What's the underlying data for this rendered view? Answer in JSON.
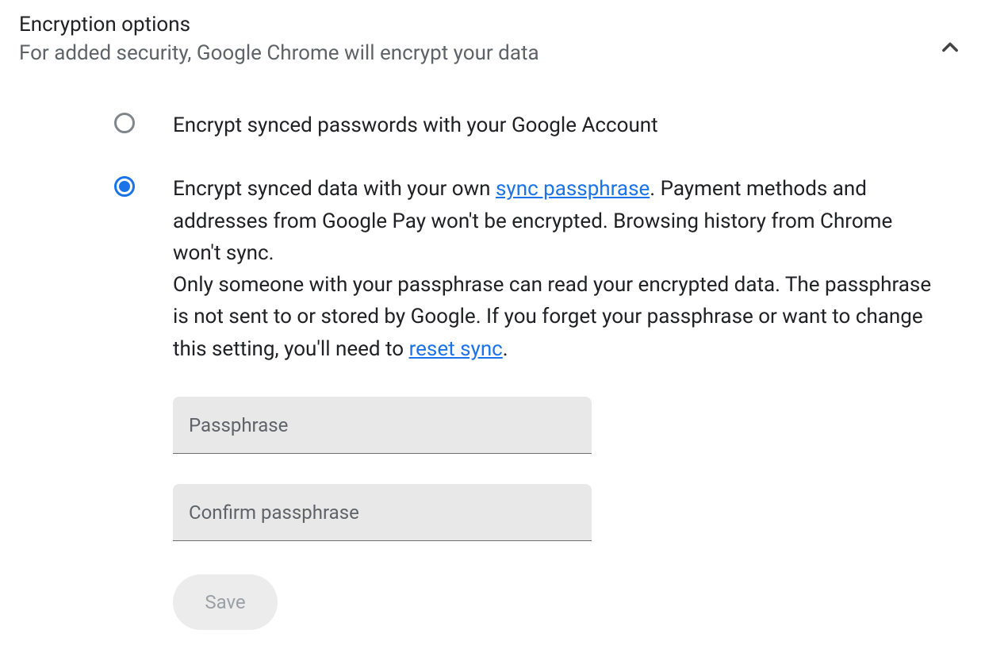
{
  "header": {
    "title": "Encryption options",
    "subtitle": "For added security, Google Chrome will encrypt your data"
  },
  "options": {
    "google_account": {
      "label": "Encrypt synced passwords with your Google Account",
      "selected": false
    },
    "passphrase": {
      "selected": true,
      "text_before_link1": "Encrypt synced data with your own ",
      "link1_text": "sync passphrase",
      "text_after_link1": ". Payment methods and addresses from Google Pay won't be encrypted. Browsing history from Chrome won't sync.",
      "para2_before_link": "Only someone with your passphrase can read your encrypted data. The passphrase is not sent to or stored by Google. If you forget your passphrase or want to change this setting, you'll need to ",
      "link2_text": "reset sync",
      "para2_after_link": "."
    }
  },
  "fields": {
    "passphrase_placeholder": "Passphrase",
    "confirm_placeholder": "Confirm passphrase",
    "passphrase_value": "",
    "confirm_value": ""
  },
  "buttons": {
    "save_label": "Save"
  }
}
